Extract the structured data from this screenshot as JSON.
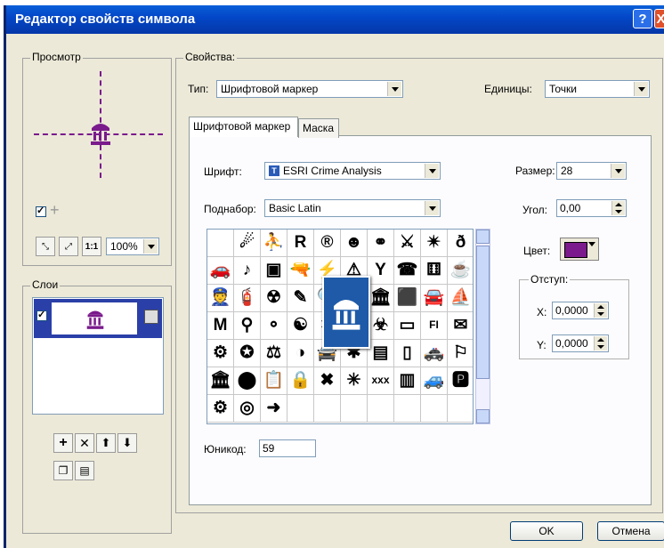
{
  "window": {
    "title": "Редактор свойств символа",
    "help_label": "?",
    "close_label": "X"
  },
  "colors": {
    "title_bar": "#0347c8",
    "symbol": "#7a1a8c",
    "highlight": "#1e5aa8"
  },
  "preview": {
    "legend": "Просмотр",
    "zoom_value": "100%",
    "zoom_options": [
      "100%"
    ],
    "tools": [
      "zoom-in-icon",
      "zoom-out-icon",
      "actual-size-icon"
    ],
    "actual_size_label": "1:1",
    "add_icon_label": "+"
  },
  "layers": {
    "legend": "Слои",
    "add_label": "+",
    "remove_label": "✕",
    "up_label": "⬆",
    "down_label": "⬇"
  },
  "properties": {
    "legend": "Свойства:",
    "type_label": "Тип:",
    "type_value": "Шрифтовой маркер",
    "units_label": "Единицы:",
    "units_value": "Точки",
    "tabs": [
      "Шрифтовой маркер",
      "Маска"
    ],
    "font_label": "Шрифт:",
    "font_value": "ESRI Crime Analysis",
    "subset_label": "Поднабор:",
    "subset_value": "Basic Latin",
    "size_label": "Размер:",
    "size_value": "28",
    "angle_label": "Угол:",
    "angle_value": "0,00",
    "color_label": "Цвет:",
    "color_value": "#7a1a8c",
    "offset_legend": "Отступ:",
    "x_label": "X:",
    "x_value": "0,0000",
    "y_label": "Y:",
    "y_value": "0,0000",
    "unicode_label": "Юникод:",
    "unicode_value": "59"
  },
  "glyphs": [
    "",
    "☄",
    "⛹",
    "R",
    "®",
    "☻",
    "⚭",
    "⚔",
    "✴",
    "ð",
    "🚗",
    "♪",
    "▣",
    "🔫",
    "⚡",
    "⚠",
    "Y",
    "☎",
    "⚅",
    "☕",
    "👮",
    "🧯",
    "☢",
    "✎",
    "🔍",
    "",
    "🏛",
    "⬛",
    "🚘",
    "⛵",
    "M",
    "⚲",
    "⚬",
    "☯",
    "✶",
    "▬",
    "☣",
    "▭",
    "FI",
    "✉",
    "⚙",
    "✪",
    "⚖",
    "◑",
    "🚔",
    "✱",
    "▤",
    "▯",
    "🚓",
    "⚐",
    "🏛",
    "⬤",
    "📋",
    "🔒",
    "✖",
    "✳",
    "xxx",
    "▥",
    "🚙",
    "🅿",
    "⚙",
    "◎",
    "➜",
    "",
    "",
    "",
    "",
    "",
    "",
    ""
  ],
  "buttons": {
    "ok": "OK",
    "cancel": "Отмена"
  }
}
